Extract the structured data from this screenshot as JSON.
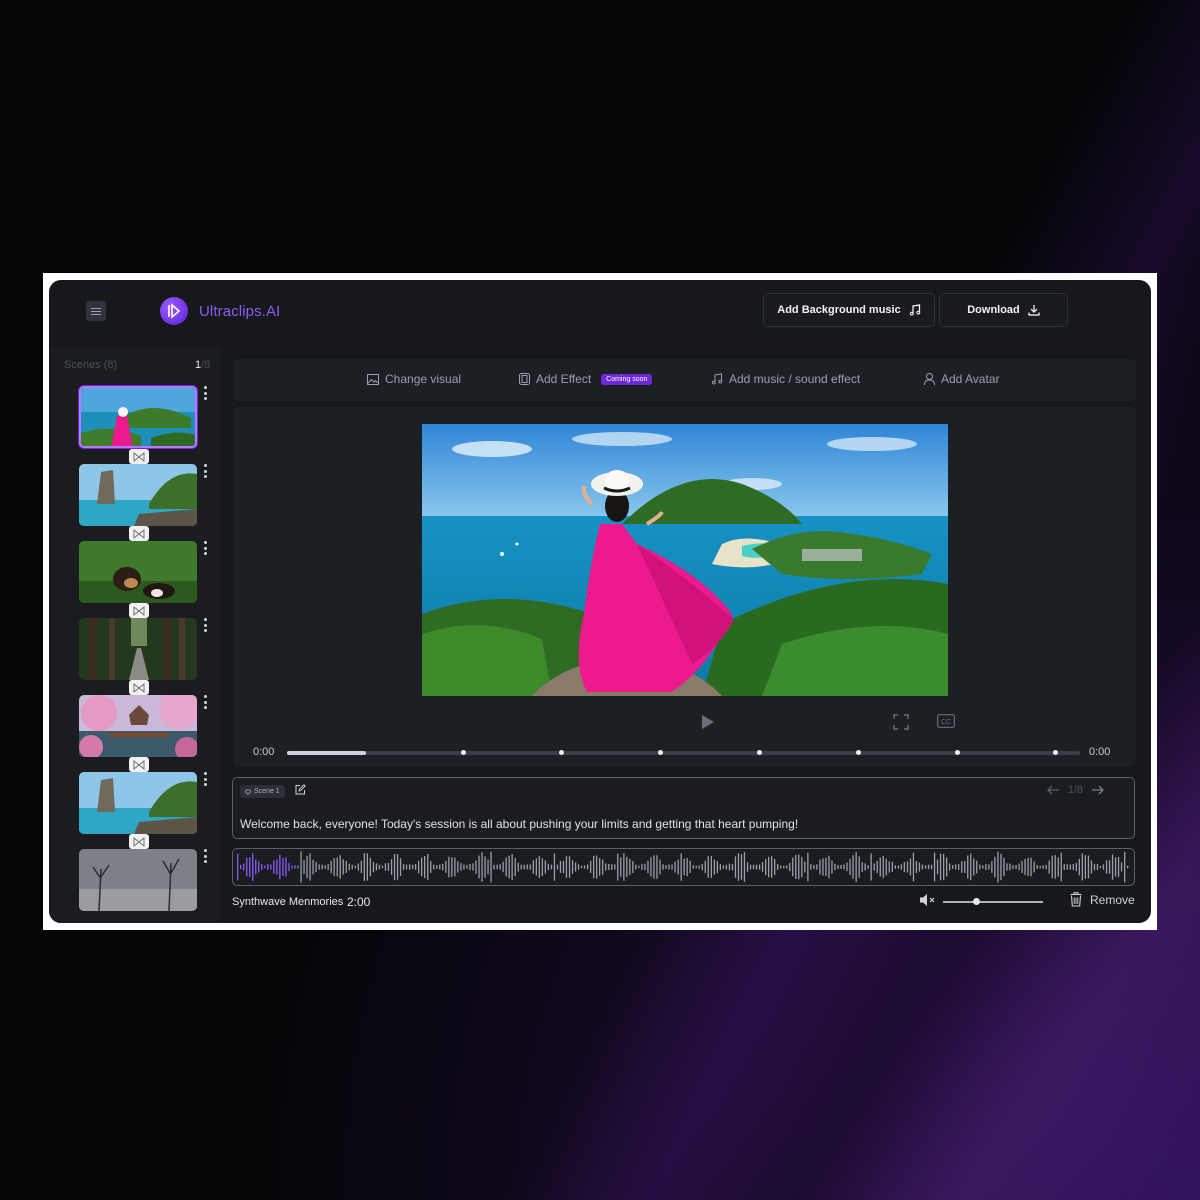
{
  "header": {
    "brand": "Ultraclips.AI",
    "add_music_label": "Add Background music",
    "download_label": "Download"
  },
  "sidebar": {
    "title": "Scenes (8)",
    "current": "1",
    "total": "/8",
    "thumbnails": [
      {
        "name": "thumb-island-woman",
        "active": true
      },
      {
        "name": "thumb-rock-island"
      },
      {
        "name": "thumb-dog"
      },
      {
        "name": "thumb-forest"
      },
      {
        "name": "thumb-cherry-blossom"
      },
      {
        "name": "thumb-rock-island-2"
      },
      {
        "name": "thumb-winter-trees"
      }
    ]
  },
  "toolbar": {
    "change_visual": "Change visual",
    "add_effect": "Add Effect",
    "coming_soon": "Coming soon",
    "add_music": "Add  music / sound effect",
    "add_avatar": "Add Avatar"
  },
  "player": {
    "time_start": "0:00",
    "time_end": "0:00",
    "progress": 0.1,
    "markers": 7
  },
  "script": {
    "scene_label": "Scene 1",
    "counter": "1/8",
    "text": "Welcome back, everyone! Today's session is all about pushing your limits and getting that heart pumping!"
  },
  "music": {
    "name": "Synthwave Menmories",
    "duration": "2:00",
    "volume": 0.33,
    "remove_label": "Remove"
  },
  "colors": {
    "accent": "#8b5cf6",
    "background": "#16181c",
    "panel": "#1c1f24"
  }
}
